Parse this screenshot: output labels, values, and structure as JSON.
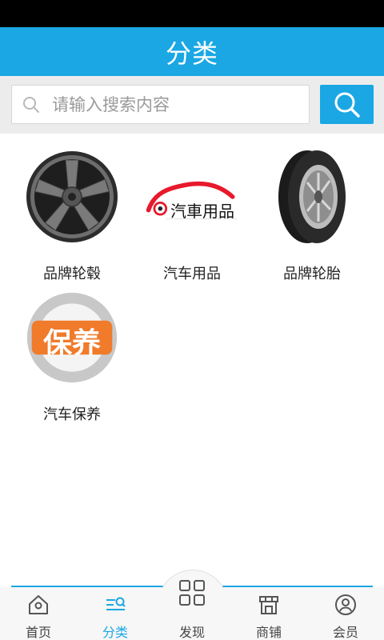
{
  "header": {
    "title": "分类"
  },
  "search": {
    "placeholder": "请输入搜索内容",
    "icon": "search-icon",
    "button_icon": "search-icon"
  },
  "categories": [
    {
      "label": "品牌轮毂",
      "image": "alloy-wheel"
    },
    {
      "label": "汽车用品",
      "image": "car-supplies-logo",
      "logo_text": "汽車用品"
    },
    {
      "label": "品牌轮胎",
      "image": "tire"
    },
    {
      "label": "汽车保养",
      "image": "maintenance-badge",
      "logo_text": "保养"
    }
  ],
  "tabbar": {
    "items": [
      {
        "label": "首页",
        "icon": "home-icon",
        "active": false
      },
      {
        "label": "分类",
        "icon": "category-icon",
        "active": true
      },
      {
        "label": "发现",
        "icon": "grid-icon",
        "active": false
      },
      {
        "label": "商铺",
        "icon": "shop-icon",
        "active": false
      },
      {
        "label": "会员",
        "icon": "member-icon",
        "active": false
      }
    ]
  },
  "colors": {
    "accent": "#1aa7e4",
    "status_bar": "#000000",
    "search_area": "#ececec",
    "maintenance_orange": "#f07b2a",
    "logo_red": "#e8192c"
  }
}
